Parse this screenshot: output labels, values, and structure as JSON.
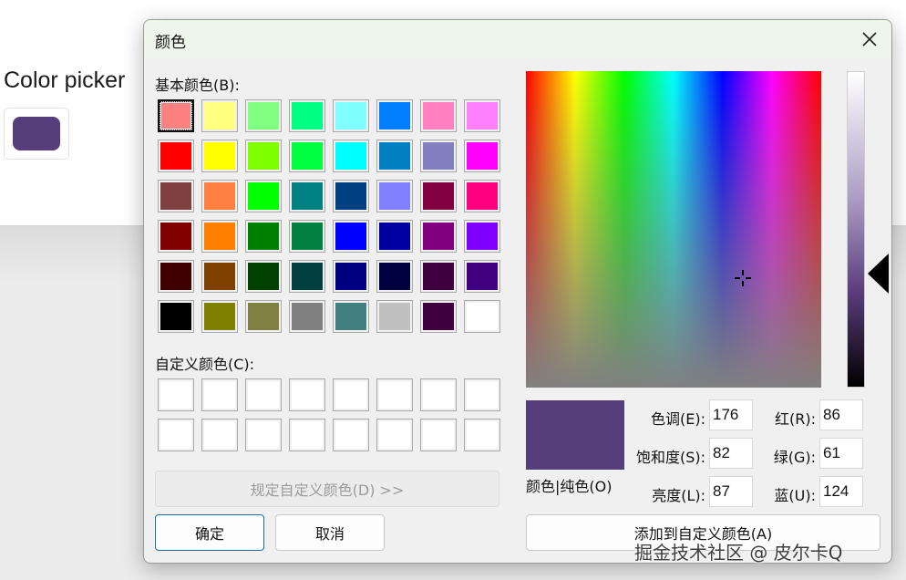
{
  "page": {
    "title": "Color picker",
    "selected_color": "#563d7c"
  },
  "dialog": {
    "title": "颜色",
    "close_icon": "close-icon",
    "basic_label": "基本颜色(B):",
    "basic_colors": [
      "#ff8080",
      "#ffff80",
      "#80ff80",
      "#00ff80",
      "#80ffff",
      "#0080ff",
      "#ff80c0",
      "#ff80ff",
      "#ff0000",
      "#ffff00",
      "#80ff00",
      "#00ff40",
      "#00ffff",
      "#0080c0",
      "#8080c0",
      "#ff00ff",
      "#804040",
      "#ff8040",
      "#00ff00",
      "#008080",
      "#004080",
      "#8080ff",
      "#800040",
      "#ff0080",
      "#800000",
      "#ff8000",
      "#008000",
      "#008040",
      "#0000ff",
      "#0000a0",
      "#800080",
      "#8000ff",
      "#400000",
      "#804000",
      "#004000",
      "#004040",
      "#000080",
      "#000040",
      "#400040",
      "#400080",
      "#000000",
      "#808000",
      "#808040",
      "#808080",
      "#408080",
      "#c0c0c0",
      "#400040",
      "#ffffff"
    ],
    "custom_label": "自定义颜色(C):",
    "custom_count": 16,
    "define_custom_button": "规定自定义颜色(D) >>",
    "ok_button": "确定",
    "cancel_button": "取消",
    "preview_label": "颜色|纯色(O)",
    "add_custom_button": "添加到自定义颜色(A)",
    "fields": {
      "hue_label": "色调(E):",
      "hue": "176",
      "sat_label": "饱和度(S):",
      "sat": "82",
      "lum_label": "亮度(L):",
      "lum": "87",
      "red_label": "红(R):",
      "red": "86",
      "green_label": "绿(G):",
      "green": "61",
      "blue_label": "蓝(U):",
      "blue": "124"
    }
  },
  "watermark": "掘金技术社区 @ 皮尔卡Q"
}
